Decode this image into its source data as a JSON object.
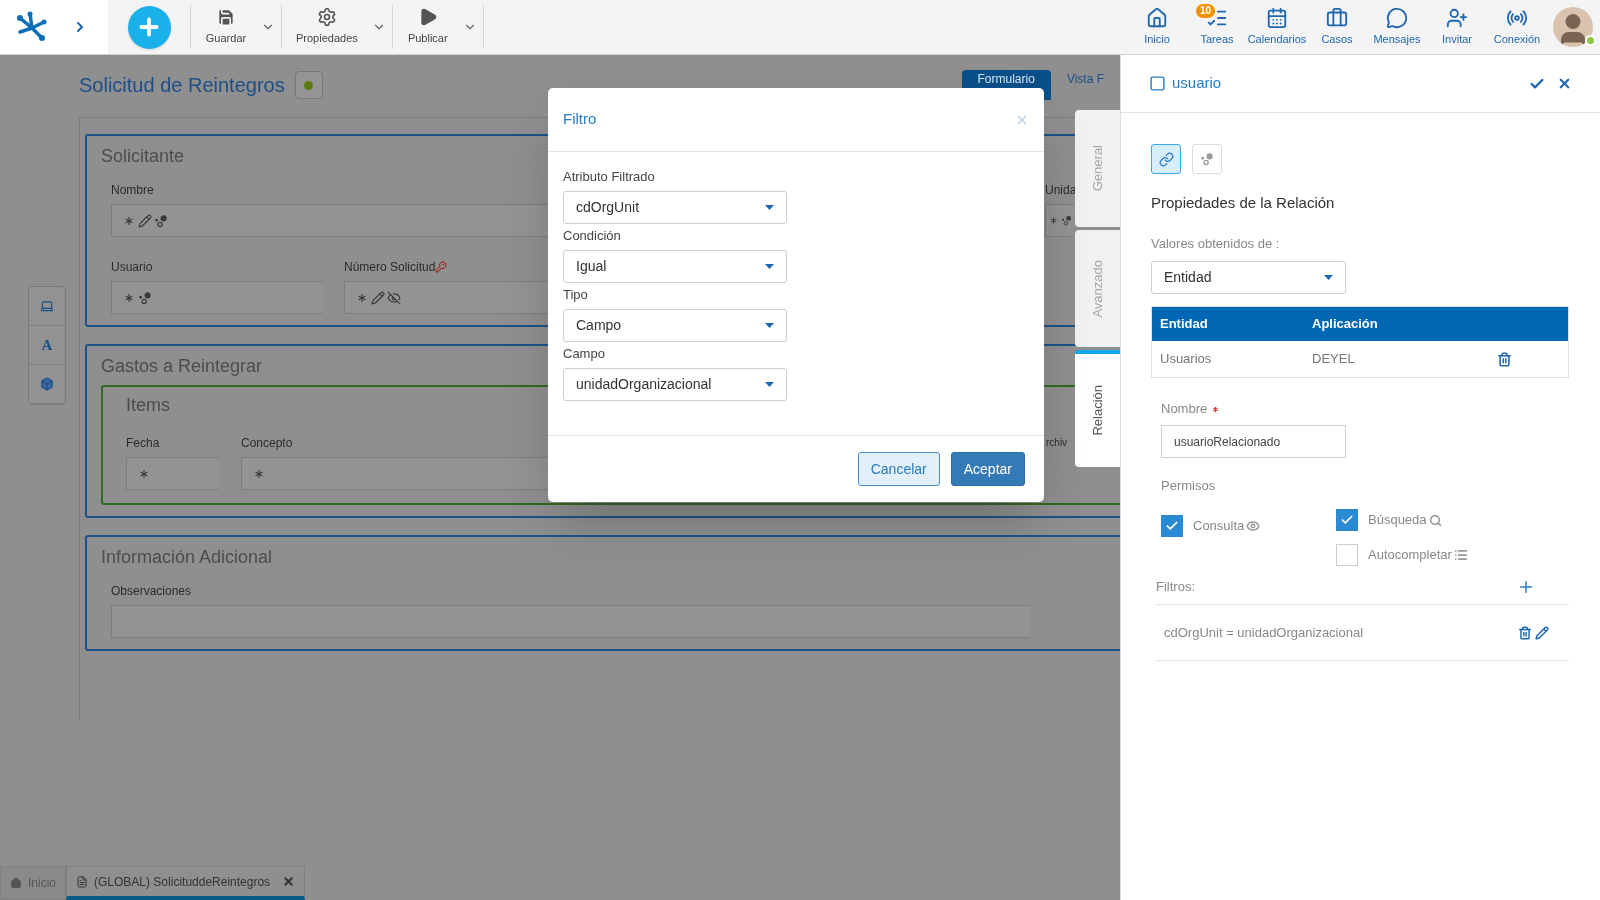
{
  "topbar": {
    "actions": [
      {
        "label": "Guardar",
        "kind": "save"
      },
      {
        "label": "Propiedades",
        "kind": "settings"
      },
      {
        "label": "Publicar",
        "kind": "publish"
      }
    ],
    "nav": [
      {
        "label": "Inicio",
        "kind": "home"
      },
      {
        "label": "Tareas",
        "kind": "tasks",
        "badge": "10"
      },
      {
        "label": "Calendarios",
        "kind": "calendar"
      },
      {
        "label": "Casos",
        "kind": "cases"
      },
      {
        "label": "Mensajes",
        "kind": "messages"
      },
      {
        "label": "Invitar",
        "kind": "invite"
      },
      {
        "label": "Conexión",
        "kind": "connection"
      }
    ]
  },
  "form": {
    "title": "Solicitud de Reintegros",
    "tabs": [
      {
        "label": "Formulario",
        "selected": true
      },
      {
        "label": "Vista F",
        "selected": false
      }
    ],
    "side_tools": [
      {
        "kind": "screen"
      },
      {
        "kind": "text",
        "label": "A"
      },
      {
        "kind": "cube"
      }
    ],
    "sections": [
      {
        "title": "Solicitante",
        "rows": [
          [
            {
              "label": "Nombre",
              "required": true,
              "editable": true,
              "relation": true
            },
            {
              "label": "Unida",
              "required": true,
              "relation": true
            }
          ],
          [
            {
              "label": "Usuario",
              "required": true,
              "relation": true
            },
            {
              "label": "Número Solicitud",
              "key": true,
              "required": true,
              "editable": true,
              "hidden": true
            }
          ]
        ]
      },
      {
        "title": "Gastos a Reintegrar",
        "groups": [
          {
            "title": "Items",
            "fields": [
              {
                "label": "Fecha",
                "required": true
              },
              {
                "label": "Concepto",
                "required": true
              },
              {
                "label": "rchiv"
              }
            ]
          }
        ]
      },
      {
        "title": "Información Adicional",
        "rows": [
          [
            {
              "label": "Observaciones"
            }
          ]
        ]
      }
    ]
  },
  "vertical_tabs": [
    {
      "label": "General",
      "selected": false
    },
    {
      "label": "Avanzado",
      "selected": false
    },
    {
      "label": "Relación",
      "selected": true
    }
  ],
  "bottom_tabs": [
    {
      "label": "Inicio",
      "kind": "home",
      "selected": false,
      "closable": false
    },
    {
      "label": "(GLOBAL) SolicituddeReintegros",
      "kind": "form",
      "selected": true,
      "closable": true
    }
  ],
  "modal": {
    "title": "Filtro",
    "fields": [
      {
        "label": "Atributo Filtrado",
        "value": "cdOrgUnit"
      },
      {
        "label": "Condición",
        "value": "Igual"
      },
      {
        "label": "Tipo",
        "value": "Campo"
      },
      {
        "label": "Campo",
        "value": "unidadOrganizacional"
      }
    ],
    "buttons": [
      {
        "label": "Cancelar",
        "kind": "secondary"
      },
      {
        "label": "Aceptar",
        "kind": "primary"
      }
    ]
  },
  "panel": {
    "title": "usuario",
    "modes": [
      {
        "kind": "link",
        "selected": true
      },
      {
        "kind": "relation",
        "selected": false
      }
    ],
    "heading": "Propiedades de la Relación",
    "source": {
      "label": "Valores obtenidos de :",
      "value": "Entidad"
    },
    "table": {
      "columns": [
        "Entidad",
        "Aplicación"
      ],
      "rows": [
        [
          "Usuarios",
          "DEYEL"
        ]
      ]
    },
    "name": {
      "label": "Nombre",
      "required": true,
      "value": "usuarioRelacionado"
    },
    "permissions": {
      "label": "Permisos",
      "items": [
        {
          "label": "Consulta",
          "kind": "view",
          "checked": true
        },
        {
          "label": "Búsqueda",
          "kind": "search",
          "checked": true
        },
        {
          "label": "Autocompletar",
          "kind": "autocomplete",
          "checked": false
        }
      ]
    },
    "filters": {
      "label": "Filtros:",
      "items": [
        "cdOrgUnit = unidadOrganizacional"
      ]
    }
  }
}
